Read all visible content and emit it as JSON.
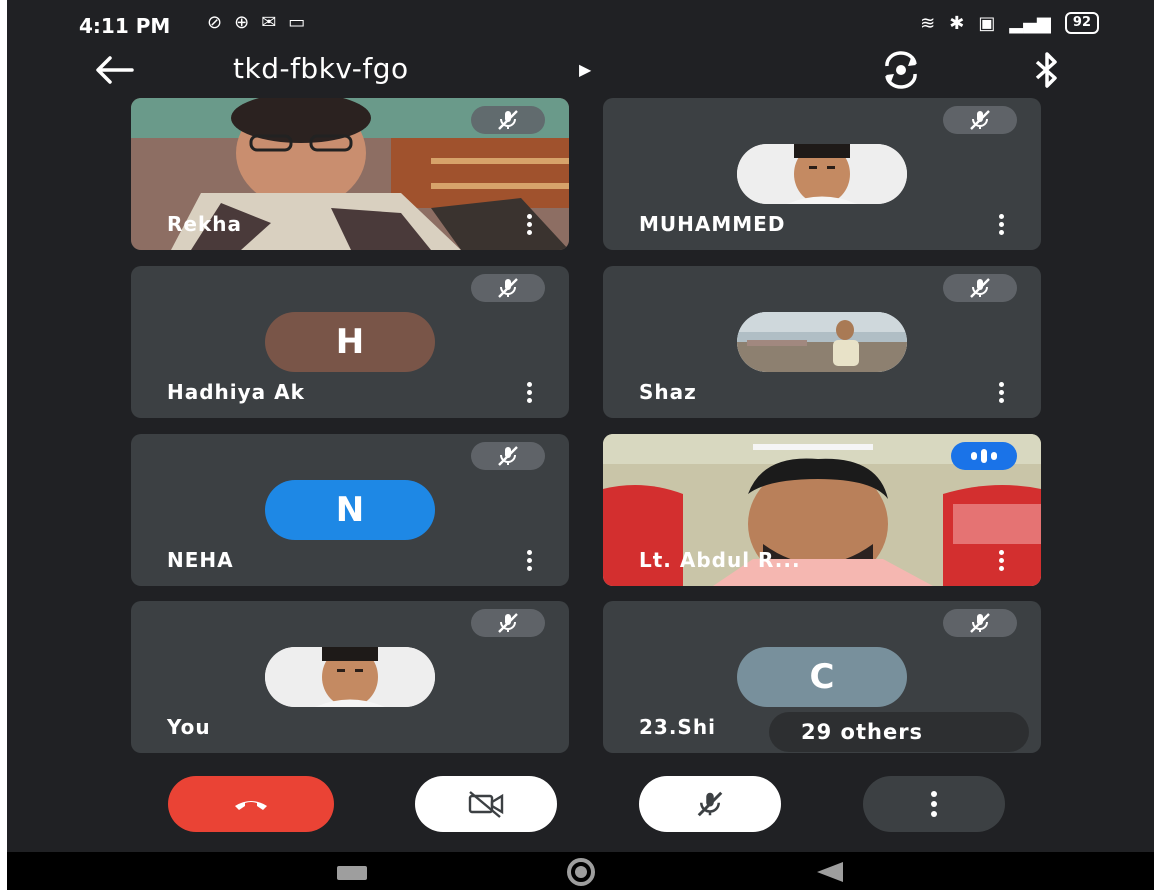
{
  "status_bar": {
    "time": "4:11 PM",
    "battery": "92"
  },
  "meeting": {
    "title": "tkd-fbkv-fgo"
  },
  "participants": [
    {
      "name": "Rekha",
      "type": "video",
      "muted": true
    },
    {
      "name": "MUHAMMED",
      "type": "photo",
      "muted": true
    },
    {
      "name": "Hadhiya Ak",
      "type": "letter",
      "initial": "H",
      "color": "#795548",
      "muted": true
    },
    {
      "name": "Shaz",
      "type": "photo",
      "muted": true
    },
    {
      "name": "NEHA",
      "type": "letter",
      "initial": "N",
      "color": "#1e88e5",
      "muted": true
    },
    {
      "name": "Lt. Abdul R...",
      "type": "video",
      "muted": false,
      "speaking": true
    },
    {
      "name": "You",
      "type": "photo",
      "muted": true
    },
    {
      "name": "23.Shi",
      "type": "letter",
      "initial": "C",
      "color": "#78909c",
      "muted": true
    }
  ],
  "others_label": "29 others",
  "colors": {
    "end_call": "#ea4335",
    "speaking": "#1a73e8",
    "tile_bg": "#3c4043"
  }
}
